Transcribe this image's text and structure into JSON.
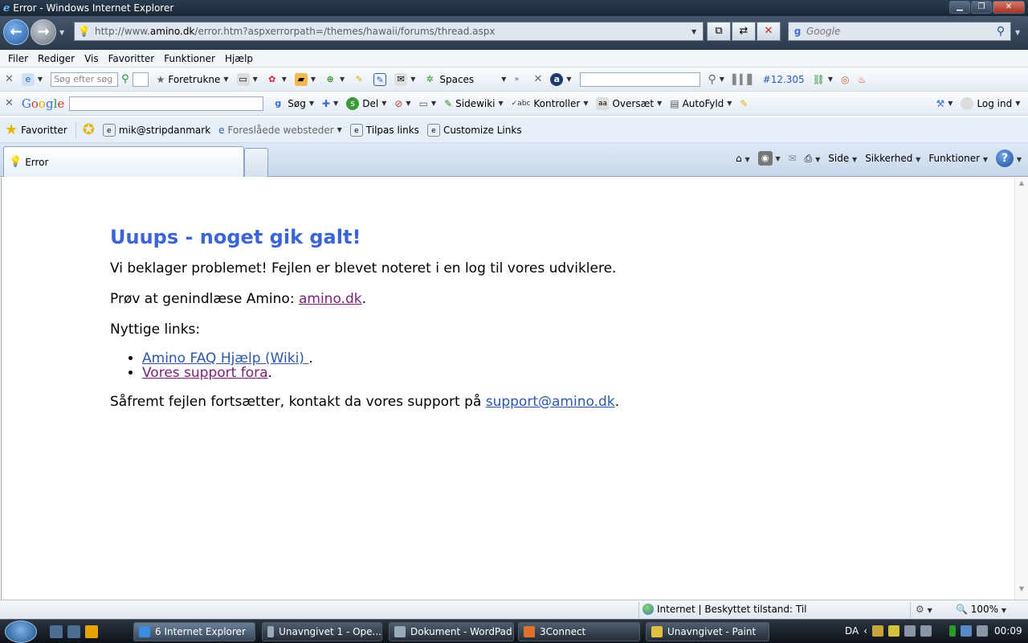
{
  "window": {
    "title": "Error - Windows Internet Explorer"
  },
  "address_bar": {
    "url_prefix": "http://www.",
    "url_host": "amino.dk",
    "url_path": "/error.htm?aspxerrorpath=/themes/hawaii/forums/thread.aspx"
  },
  "search_bar": {
    "placeholder": "Google"
  },
  "menu": [
    "Filer",
    "Rediger",
    "Vis",
    "Favoritter",
    "Funktioner",
    "Hjælp"
  ],
  "toolbar1": {
    "search_placeholder": "Søg efter søg",
    "favorites_label": "Foretrukne",
    "spaces_label": "Spaces",
    "rank_label": "#12.305"
  },
  "toolbar2": {
    "google_logo": "Google",
    "search_label": "Søg",
    "share_label": "Del",
    "sidewiki_label": "Sidewiki",
    "check_label": "Kontroller",
    "translate_label": "Oversæt",
    "autofill_label": "AutoFyld",
    "login_label": "Log ind"
  },
  "favorites_bar": {
    "favorites_label": "Favoritter",
    "items": [
      "mik@stripdanmark",
      "Foreslåede websteder",
      "Tilpas links",
      "Customize Links"
    ]
  },
  "tab": {
    "title": "Error"
  },
  "command_bar": {
    "page_label": "Side",
    "safety_label": "Sikkerhed",
    "tools_label": "Funktioner"
  },
  "page": {
    "heading": "Uuups - noget gik galt!",
    "p1": "Vi beklager problemet! Fejlen er blevet noteret i en log til vores udviklere.",
    "p2_prefix": "Prøv at genindlæse Amino: ",
    "p2_link": "amino.dk",
    "p2_suffix": ".",
    "p3": "Nyttige links:",
    "links": [
      {
        "label": "Amino FAQ Hjælp (Wiki) ",
        "suffix": "."
      },
      {
        "label": "Vores support fora",
        "suffix": "."
      }
    ],
    "p4_prefix": "Såfremt fejlen fortsætter, kontakt da vores support på ",
    "p4_link": "support@amino.dk",
    "p4_suffix": "."
  },
  "status_bar": {
    "zone": "Internet | Beskyttet tilstand: Til",
    "zoom": "100%"
  },
  "taskbar": {
    "buttons": [
      "6 Internet Explorer",
      "Unavngivet 1 - Ope...",
      "Dokument - WordPad",
      "3Connect",
      "Unavngivet - Paint"
    ],
    "language": "DA",
    "clock": "00:09"
  },
  "colors": {
    "heading": "#3b64d8",
    "link": "#2b58a8",
    "visited_link": "#7a1e7a"
  }
}
